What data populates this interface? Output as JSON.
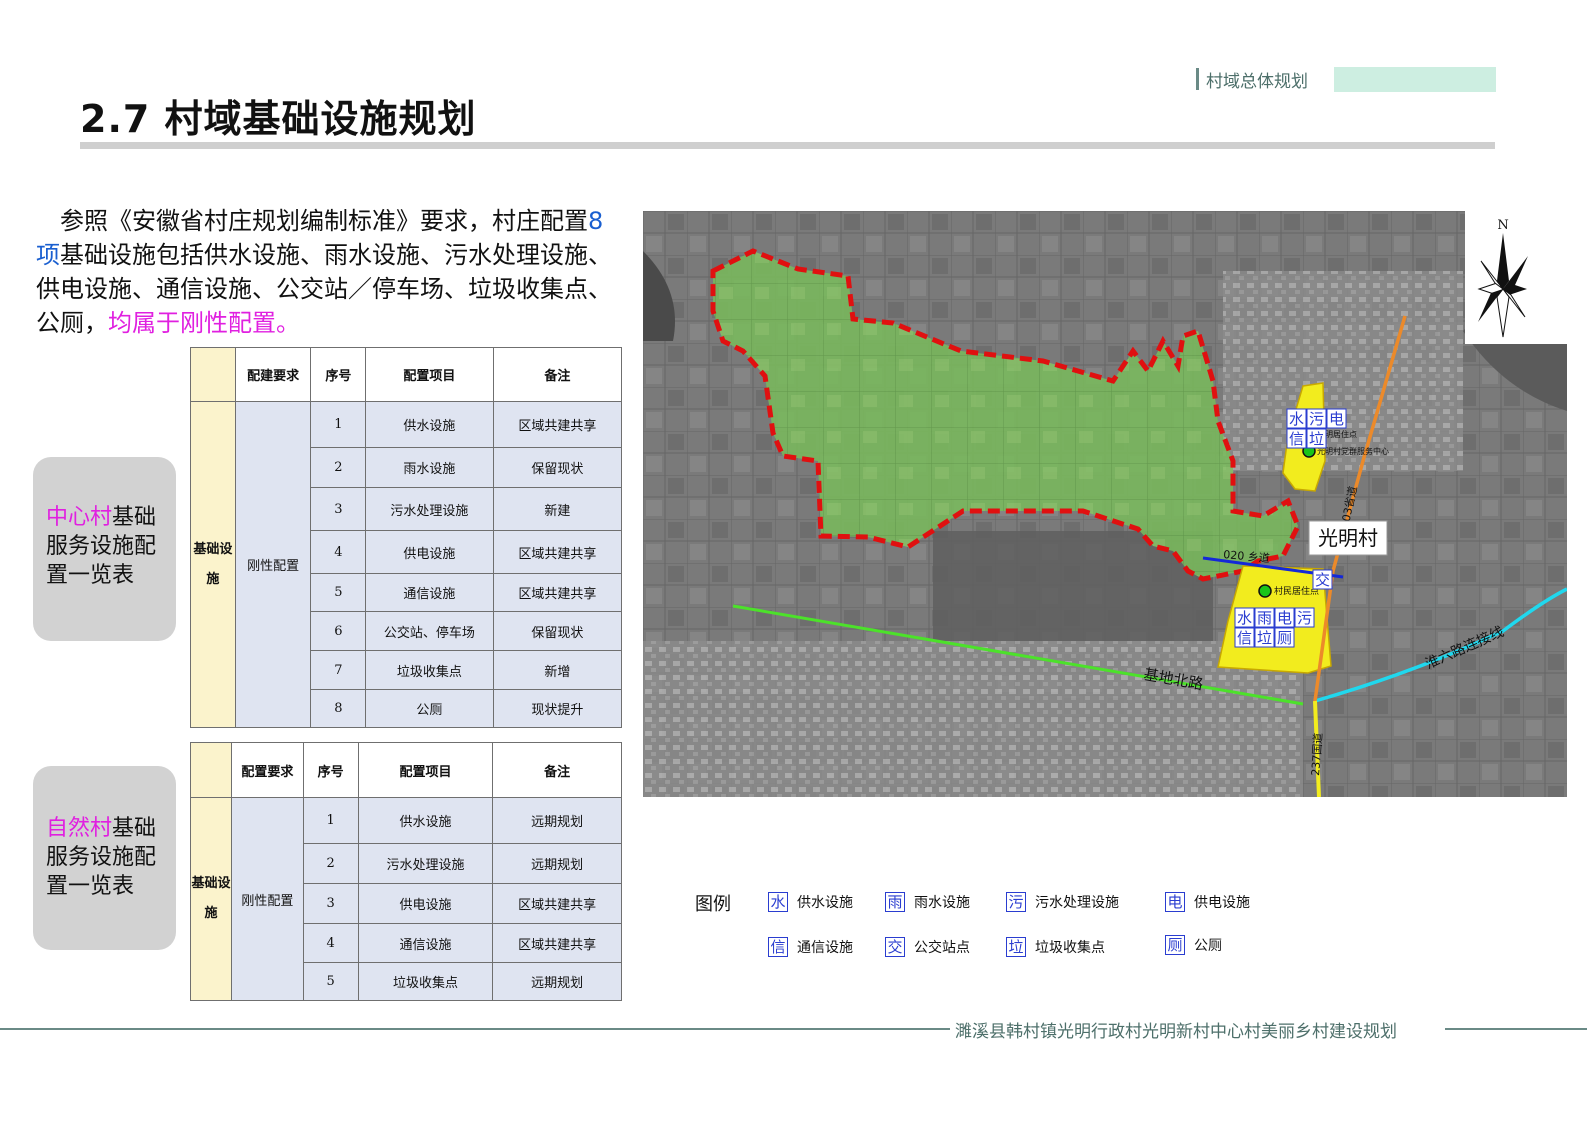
{
  "header": {
    "section_tag": "村域总体规划",
    "title": "2.7  村域基础设施规划"
  },
  "intro": {
    "part1": "参照《安徽省村庄规划编制标准》要求，村庄配置",
    "count": "8 项",
    "part2": "基础设施包括供水设施、雨水设施、污水处理设施、供电设施、通信设施、公交站／停车场、垃圾收集点、公厕，",
    "highlight": "均属于刚性配置。"
  },
  "central_village": {
    "label_highlight": "中心村",
    "label_rest": "基础服务设施配置一览表",
    "table": {
      "headers": [
        "配建要求",
        "序号",
        "配置项目",
        "备注"
      ],
      "category": "基础设施",
      "requirement": "刚性配置",
      "rows": [
        {
          "no": "1",
          "item": "供水设施",
          "note": "区域共建共享"
        },
        {
          "no": "2",
          "item": "雨水设施",
          "note": "保留现状"
        },
        {
          "no": "3",
          "item": "污水处理设施",
          "note": "新建"
        },
        {
          "no": "4",
          "item": "供电设施",
          "note": "区域共建共享"
        },
        {
          "no": "5",
          "item": "通信设施",
          "note": "区域共建共享"
        },
        {
          "no": "6",
          "item": "公交站、停车场",
          "note": "保留现状"
        },
        {
          "no": "7",
          "item": "垃圾收集点",
          "note": "新增"
        },
        {
          "no": "8",
          "item": "公厕",
          "note": "现状提升"
        }
      ]
    }
  },
  "natural_village": {
    "label_highlight": "自然村",
    "label_rest": "基础服务设施配置一览表",
    "table": {
      "headers": [
        "配置要求",
        "序号",
        "配置项目",
        "备注"
      ],
      "category": "基础设施",
      "requirement": "刚性配置",
      "rows": [
        {
          "no": "1",
          "item": "供水设施",
          "note": "远期规划"
        },
        {
          "no": "2",
          "item": "污水处理设施",
          "note": "远期规划"
        },
        {
          "no": "3",
          "item": "供电设施",
          "note": "区域共建共享"
        },
        {
          "no": "4",
          "item": "通信设施",
          "note": "区域共建共享"
        },
        {
          "no": "5",
          "item": "垃圾收集点",
          "note": "远期规划"
        }
      ]
    }
  },
  "map": {
    "north": "N",
    "village_name": "光明村",
    "roads": {
      "county_road": "020 乡道",
      "jidi_road": "基地北路",
      "huailiu_link": "淮六路连接线",
      "national_road_n": "203省道",
      "national_road_s": "237国道"
    },
    "points": {
      "upper": "光明居住点",
      "upper_center": "光明村党群服务中心",
      "lower": "村民居住点"
    },
    "upper_icons": [
      "水",
      "污",
      "电",
      "信",
      "垃"
    ],
    "bus_icon": "交",
    "lower_icons": [
      "水",
      "雨",
      "电",
      "污",
      "信",
      "垃",
      "厕"
    ],
    "colors": {
      "boundary": "#e01010",
      "village_area": "#7fcf5f",
      "settlement": "#f2ec1e",
      "county_road": "#1428d8",
      "jidi_road": "#4ce22a",
      "huailiu_link": "#20d8ee",
      "national_road": "#ec8a2a"
    }
  },
  "legend": {
    "title": "图例",
    "items": [
      {
        "icon": "水",
        "label": "供水设施"
      },
      {
        "icon": "雨",
        "label": "雨水设施"
      },
      {
        "icon": "污",
        "label": "污水处理设施"
      },
      {
        "icon": "电",
        "label": "供电设施"
      },
      {
        "icon": "信",
        "label": "通信设施"
      },
      {
        "icon": "交",
        "label": "公交站点"
      },
      {
        "icon": "垃",
        "label": "垃圾收集点"
      },
      {
        "icon": "厕",
        "label": "公厕"
      }
    ]
  },
  "footer": "濉溪县韩村镇光明行政村光明新村中心村美丽乡村建设规划"
}
